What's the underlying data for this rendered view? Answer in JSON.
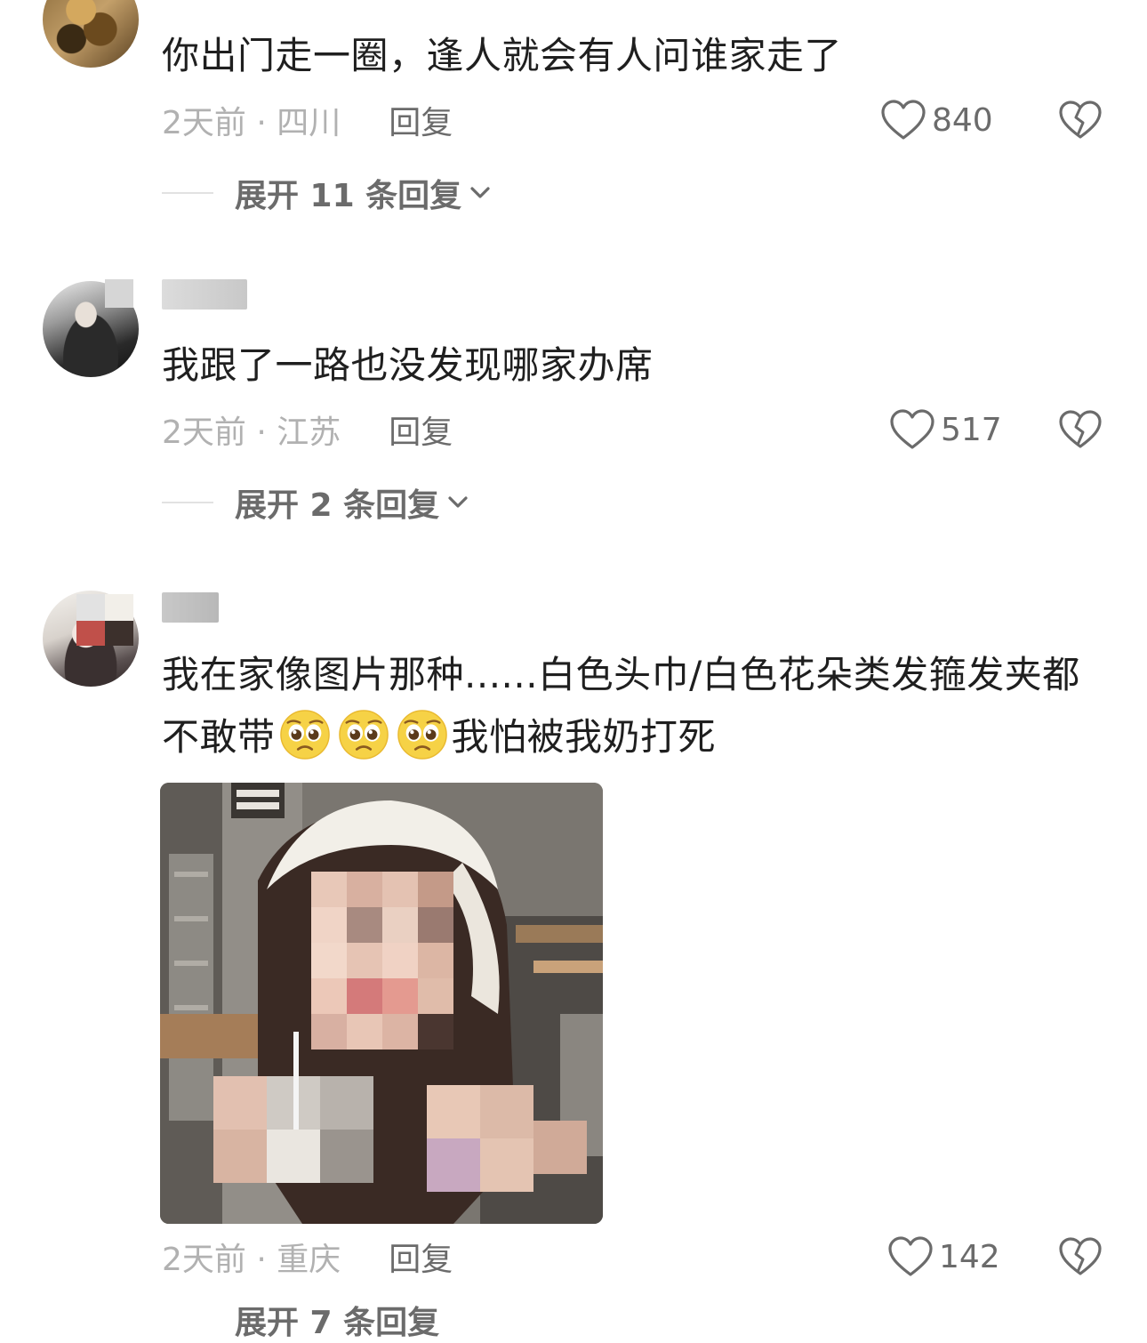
{
  "comments": [
    {
      "content": "你出门走一圈，逢人就会有人问谁家走了",
      "time_location": "2天前 · 四川",
      "reply_label": "回复",
      "like_count": "840",
      "expand_label": "展开 11 条回复"
    },
    {
      "content": "我跟了一路也没发现哪家办席",
      "time_location": "2天前 · 江苏",
      "reply_label": "回复",
      "like_count": "517",
      "expand_label": "展开 2 条回复"
    },
    {
      "content_line1": "我在家像图片那种......白色头巾/白色花朵类发箍发夹都",
      "content_line2_start": "不敢带",
      "content_line2_end": "我怕被我奶打死",
      "time_location": "2天前 · 重庆",
      "reply_label": "回复",
      "like_count": "142",
      "expand_label": "展开 7 条回复"
    }
  ],
  "icons": {
    "like": "heart-outline-icon",
    "dislike": "broken-heart-icon",
    "expand": "chevron-down-icon",
    "emoji": "pleading-face-emoji"
  },
  "colors": {
    "text_primary": "#1f1f1f",
    "text_secondary": "#6b6b6b",
    "text_muted": "#b1b1b1",
    "divider": "#e2e2e2"
  }
}
